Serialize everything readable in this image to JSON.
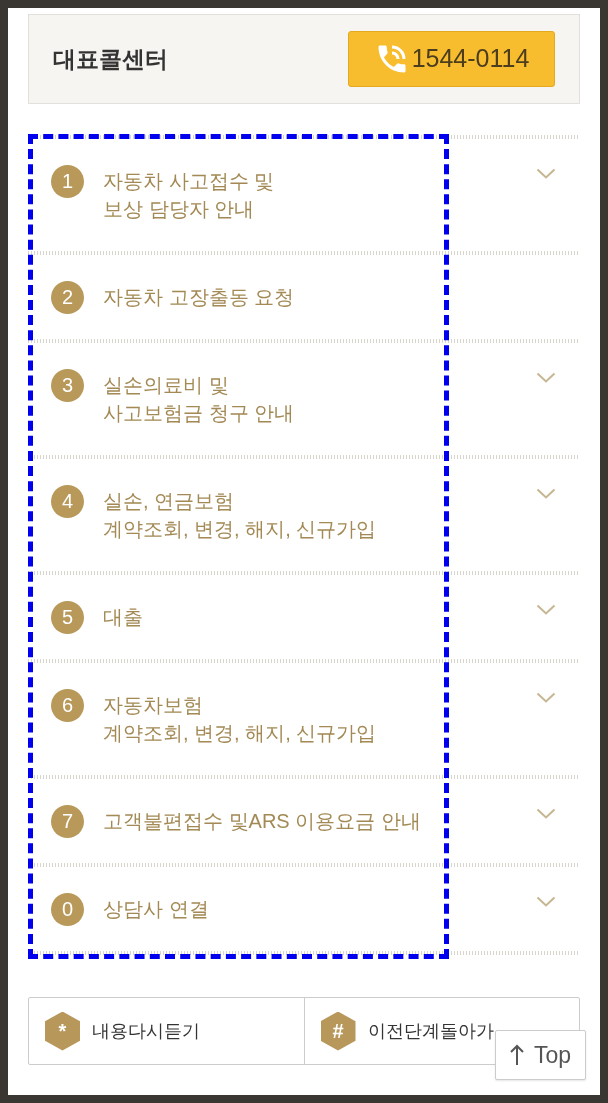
{
  "header": {
    "title": "대표콜센터",
    "phone_button": {
      "label": "1544-0114"
    }
  },
  "menu": [
    {
      "key": "1",
      "lines": [
        "자동차 사고접수 및",
        "보상 담당자 안내"
      ],
      "expandable": true
    },
    {
      "key": "2",
      "lines": [
        "자동차 고장출동 요청"
      ],
      "expandable": false
    },
    {
      "key": "3",
      "lines": [
        "실손의료비 및",
        "사고보험금 청구 안내"
      ],
      "expandable": true
    },
    {
      "key": "4",
      "lines": [
        "실손, 연금보험",
        "계약조회, 변경, 해지, 신규가입"
      ],
      "expandable": true
    },
    {
      "key": "5",
      "lines": [
        "대출"
      ],
      "expandable": true
    },
    {
      "key": "6",
      "lines": [
        "자동차보험",
        "계약조회, 변경, 해지, 신규가입"
      ],
      "expandable": true
    },
    {
      "key": "7",
      "lines": [
        "고객불편접수 및ARS 이용요금 안내"
      ],
      "expandable": true
    },
    {
      "key": "0",
      "lines": [
        "상담사 연결"
      ],
      "expandable": true
    }
  ],
  "footer_buttons": [
    {
      "key": "*",
      "label": "내용다시듣기"
    },
    {
      "key": "#",
      "label": "이전단계돌아가"
    }
  ],
  "top_button": {
    "label": "Top"
  }
}
